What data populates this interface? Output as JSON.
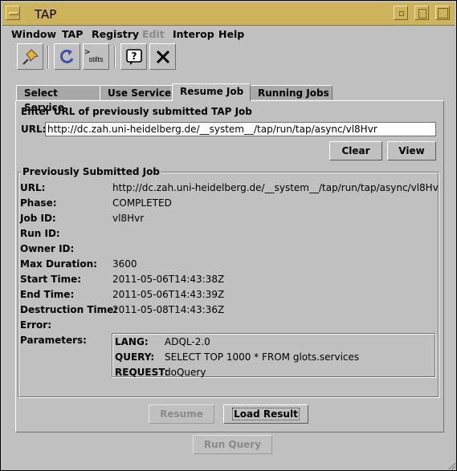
{
  "window": {
    "title": "TAP",
    "accent_color": "#ceb35d"
  },
  "menu": [
    {
      "label": "Window",
      "enabled": true
    },
    {
      "label": "TAP",
      "enabled": true
    },
    {
      "label": "Registry",
      "enabled": true
    },
    {
      "label": "Edit",
      "enabled": false
    },
    {
      "label": "Interop",
      "enabled": true
    },
    {
      "label": "Help",
      "enabled": true
    }
  ],
  "toolbar": {
    "items": [
      {
        "icon": "pin-icon"
      },
      {
        "icon": "reload-icon"
      },
      {
        "icon": "stilts-icon",
        "text": "stilts"
      },
      {
        "icon": "help-icon"
      },
      {
        "icon": "close-icon"
      }
    ]
  },
  "tabs": [
    {
      "label": "Select Service",
      "selected": false
    },
    {
      "label": "Use Service",
      "selected": false
    },
    {
      "label": "Resume Job",
      "selected": true
    },
    {
      "label": "Running Jobs",
      "selected": false
    }
  ],
  "resume": {
    "heading": "Enter URL of previously submitted TAP Job",
    "url_label": "URL:",
    "url_value": "http://dc.zah.uni-heidelberg.de/__system__/tap/run/tap/async/vl8Hvr",
    "clear_label": "Clear",
    "view_label": "View"
  },
  "job": {
    "title": "Previously Submitted Job",
    "fields": [
      {
        "label": "URL:",
        "value": "http://dc.zah.uni-heidelberg.de/__system__/tap/run/tap/async/vl8Hv"
      },
      {
        "label": "Phase:",
        "value": "COMPLETED"
      },
      {
        "label": "Job ID:",
        "value": "vl8Hvr"
      },
      {
        "label": "Run ID:",
        "value": ""
      },
      {
        "label": "Owner ID:",
        "value": ""
      },
      {
        "label": "Max Duration:",
        "value": "3600"
      },
      {
        "label": "Start Time:",
        "value": "2011-05-06T14:43:38Z"
      },
      {
        "label": "End Time:",
        "value": "2011-05-06T14:43:39Z"
      },
      {
        "label": "Destruction Time:",
        "value": "2011-05-08T14:43:36Z"
      },
      {
        "label": "Error:",
        "value": ""
      },
      {
        "label": "Parameters:",
        "value": ""
      }
    ],
    "params": [
      {
        "key": "LANG:",
        "value": "ADQL-2.0"
      },
      {
        "key": "QUERY:",
        "value": "SELECT TOP 1000 * FROM glots.services"
      },
      {
        "key": "REQUEST:",
        "value": "doQuery"
      }
    ]
  },
  "actions": {
    "resume_label": "Resume",
    "load_result_label": "Load Result",
    "run_query_label": "Run Query"
  }
}
